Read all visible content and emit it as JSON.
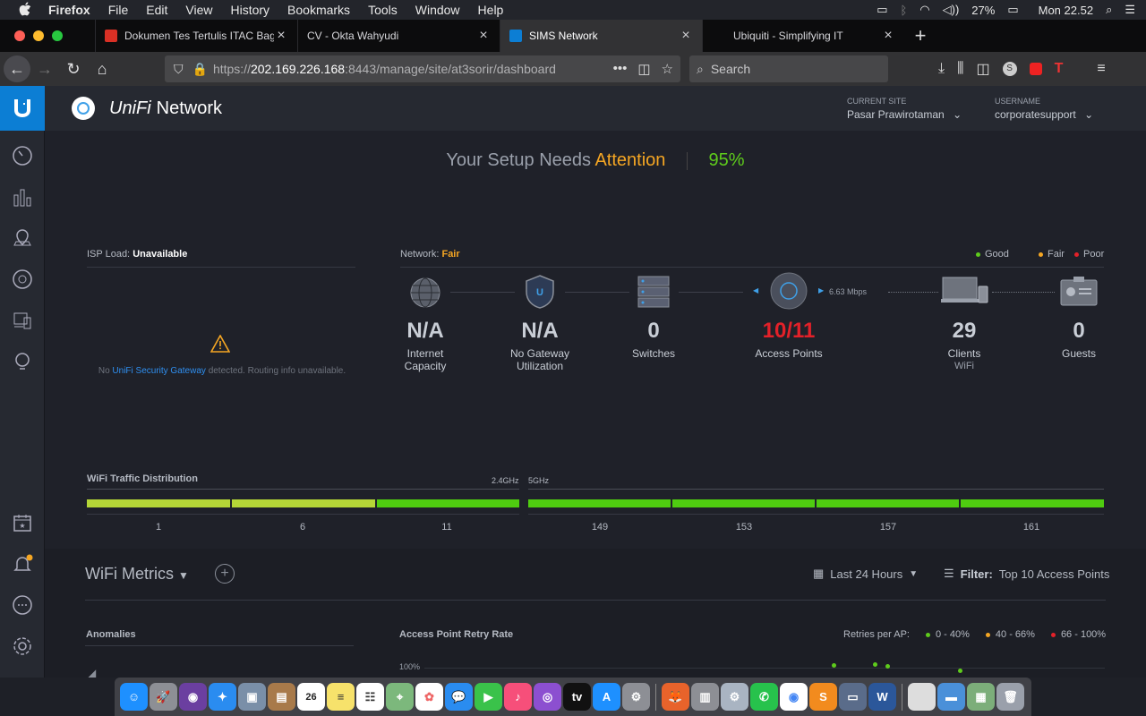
{
  "menubar": {
    "app": "Firefox",
    "items": [
      "File",
      "Edit",
      "View",
      "History",
      "Bookmarks",
      "Tools",
      "Window",
      "Help"
    ],
    "battery": "27%",
    "clock": "Mon 22.52"
  },
  "tabs": [
    {
      "title": "Dokumen Tes Tertulis ITAC Bag",
      "favicon_color": "#d93025",
      "active": false
    },
    {
      "title": "CV - Okta Wahyudi",
      "favicon_color": "",
      "active": false
    },
    {
      "title": "SIMS Network",
      "favicon_color": "#0c7ed4",
      "active": true
    },
    {
      "title": "Ubiquiti - Simplifying IT",
      "favicon_color": "",
      "active": false
    }
  ],
  "navbar": {
    "url_prefix": "https://",
    "url_host": "202.169.226.168",
    "url_rest": ":8443/manage/site/at3sorir/dashboard",
    "search_placeholder": "Search"
  },
  "header": {
    "brand_unifi": "UniFi",
    "brand_network": "Network",
    "current_site_label": "CURRENT SITE",
    "current_site": "Pasar Prawirotaman",
    "username_label": "USERNAME",
    "username": "corporatesupport"
  },
  "dashboard": {
    "attention_prefix": "Your Setup Needs",
    "attention_word": "Attention",
    "score": "95%",
    "isp_label": "ISP Load:",
    "isp_value": "Unavailable",
    "isp_warn_pre": "No",
    "isp_warn_link": "UniFi Security Gateway",
    "isp_warn_post": "detected. Routing info unavailable.",
    "network_label": "Network:",
    "network_value": "Fair",
    "legend": [
      {
        "label": "Good",
        "color": "#5ecb1c"
      },
      {
        "label": "Fair",
        "color": "#f5a623"
      },
      {
        "label": "Poor",
        "color": "#e32129"
      }
    ],
    "link_speed": "6.63 Mbps",
    "topology": [
      {
        "num": "N/A",
        "label": "Internet",
        "sub": "Capacity"
      },
      {
        "num": "N/A",
        "label": "No Gateway",
        "sub": "Utilization"
      },
      {
        "num": "0",
        "label": "Switches",
        "sub": ""
      },
      {
        "num": "10/11",
        "label": "Access Points",
        "sub": ""
      },
      {
        "num": "29",
        "label": "Clients",
        "sub": "WiFi"
      },
      {
        "num": "0",
        "label": "Guests",
        "sub": ""
      }
    ],
    "wifi_traffic_label": "WiFi Traffic Distribution",
    "band_24": "2.4GHz",
    "band_5": "5GHz",
    "channels_24": [
      "1",
      "6",
      "11"
    ],
    "channels_5": [
      "149",
      "153",
      "157",
      "161"
    ],
    "bar_colors": {
      "yellowgreen": "#b5d637",
      "green": "#4fcc10"
    }
  },
  "metrics": {
    "title": "WiFi Metrics",
    "range": "Last 24 Hours",
    "filter_label": "Filter:",
    "filter_value": "Top 10 Access Points",
    "anomalies": "Anomalies",
    "retry_rate": "Access Point Retry Rate",
    "retries_label": "Retries per AP:",
    "retry_legend": [
      {
        "label": "0 - 40%",
        "color": "#5ecb1c"
      },
      {
        "label": "40 - 66%",
        "color": "#f5a623"
      },
      {
        "label": "66 - 100%",
        "color": "#e32129"
      }
    ],
    "y_top": "100%"
  }
}
